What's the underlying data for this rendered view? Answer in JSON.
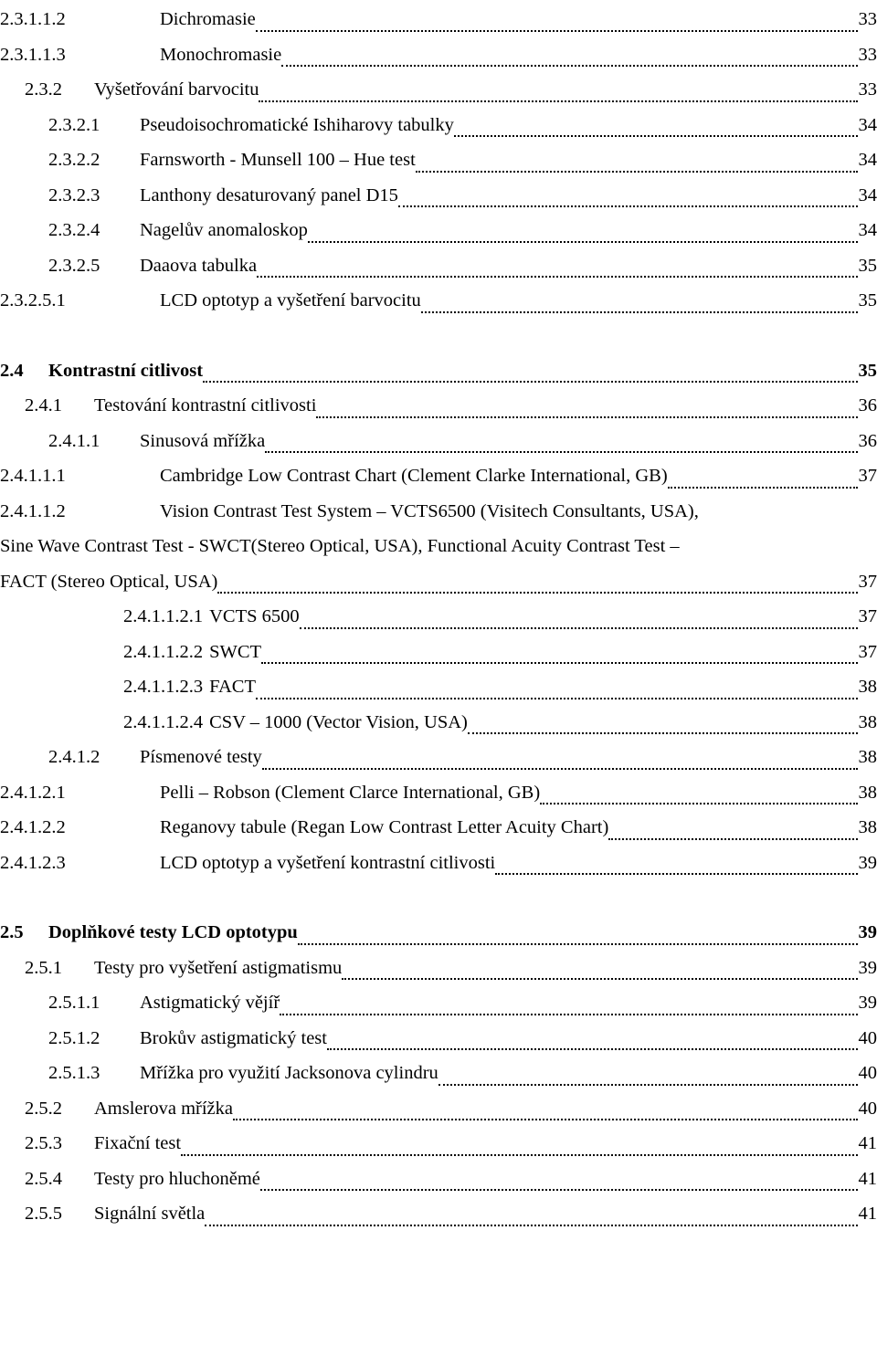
{
  "document": {
    "type": "table-of-contents",
    "language": "cs",
    "page_number_alignment": "right",
    "leader": "dotted"
  },
  "entries": [
    {
      "number": "2.3.1.1.2",
      "title": "Dichromasie",
      "page": "33",
      "level": 5,
      "bold": false
    },
    {
      "number": "2.3.1.1.3",
      "title": "Monochromasie",
      "page": "33",
      "level": 5,
      "bold": false
    },
    {
      "number": "2.3.2",
      "title": "Vyšetřování barvocitu",
      "page": "33",
      "level": 3,
      "bold": false
    },
    {
      "number": "2.3.2.1",
      "title": "Pseudoisochromatické Ishiharovy tabulky",
      "page": "34",
      "level": 4,
      "bold": false
    },
    {
      "number": "2.3.2.2",
      "title": "Farnsworth - Munsell 100 – Hue test",
      "page": "34",
      "level": 4,
      "bold": false
    },
    {
      "number": "2.3.2.3",
      "title": "Lanthony desaturovaný panel D15",
      "page": "34",
      "level": 4,
      "bold": false
    },
    {
      "number": "2.3.2.4",
      "title": "Nagelův anomaloskop",
      "page": "34",
      "level": 4,
      "bold": false
    },
    {
      "number": "2.3.2.5",
      "title": "Daaova tabulka",
      "page": "35",
      "level": 4,
      "bold": false
    },
    {
      "number": "2.3.2.5.1",
      "title": "LCD optotyp a vyšetření barvocitu",
      "page": "35",
      "level": 5,
      "bold": false
    },
    {
      "number": "2.4",
      "title": "Kontrastní citlivost",
      "page": "35",
      "level": 2,
      "bold": true,
      "space_before": true
    },
    {
      "number": "2.4.1",
      "title": "Testování kontrastní citlivosti",
      "page": "36",
      "level": 3,
      "bold": false
    },
    {
      "number": "2.4.1.1",
      "title": "Sinusová mřížka",
      "page": "36",
      "level": 4,
      "bold": false
    },
    {
      "number": "2.4.1.1.1",
      "title": "Cambridge Low Contrast Chart (Clement Clarke International, GB)",
      "page": "37",
      "level": 5,
      "bold": false
    },
    {
      "number": "2.4.1.1.2",
      "title": "Vision Contrast Test System – VCTS6500 (Visitech Consultants, USA),",
      "title_line2": "Sine Wave Contrast Test - SWCT(Stereo Optical, USA), Functional Acuity Contrast Test –",
      "title_line3": "FACT (Stereo Optical, USA)",
      "page": "37",
      "level": 5,
      "bold": false,
      "multiline": true
    },
    {
      "number": "2.4.1.1.2.1",
      "title": "VCTS 6500",
      "page": "37",
      "level": 6,
      "bold": false
    },
    {
      "number": "2.4.1.1.2.2",
      "title": "SWCT",
      "page": "37",
      "level": 6,
      "bold": false
    },
    {
      "number": "2.4.1.1.2.3",
      "title": "FACT",
      "page": "38",
      "level": 6,
      "bold": false
    },
    {
      "number": "2.4.1.1.2.4",
      "title": "CSV – 1000 (Vector Vision, USA)",
      "page": "38",
      "level": 6,
      "bold": false
    },
    {
      "number": "2.4.1.2",
      "title": "Písmenové testy",
      "page": "38",
      "level": 4,
      "bold": false
    },
    {
      "number": "2.4.1.2.1",
      "title": "Pelli – Robson (Clement Clarce International, GB)",
      "page": "38",
      "level": 5,
      "bold": false
    },
    {
      "number": "2.4.1.2.2",
      "title": "Reganovy tabule (Regan Low Contrast Letter Acuity Chart)",
      "page": "38",
      "level": 5,
      "bold": false
    },
    {
      "number": "2.4.1.2.3",
      "title": "LCD optotyp a vyšetření kontrastní citlivosti",
      "page": "39",
      "level": 5,
      "bold": false
    },
    {
      "number": "2.5",
      "title": "Doplňkové testy LCD optotypu",
      "page": "39",
      "level": 2,
      "bold": true,
      "space_before": true
    },
    {
      "number": "2.5.1",
      "title": "Testy pro vyšetření astigmatismu",
      "page": "39",
      "level": 3,
      "bold": false
    },
    {
      "number": "2.5.1.1",
      "title": "Astigmatický vějíř",
      "page": "39",
      "level": 4,
      "bold": false
    },
    {
      "number": "2.5.1.2",
      "title": "Brokův astigmatický test",
      "page": "40",
      "level": 4,
      "bold": false
    },
    {
      "number": "2.5.1.3",
      "title": "Mřížka pro využití Jacksonova cylindru",
      "page": "40",
      "level": 4,
      "bold": false
    },
    {
      "number": "2.5.2",
      "title": "Amslerova mřížka",
      "page": "40",
      "level": 3,
      "bold": false
    },
    {
      "number": "2.5.3",
      "title": "Fixační test",
      "page": "41",
      "level": 3,
      "bold": false
    },
    {
      "number": "2.5.4",
      "title": "Testy pro hluchoněmé",
      "page": "41",
      "level": 3,
      "bold": false
    },
    {
      "number": "2.5.5",
      "title": "Signální světla",
      "page": "41",
      "level": 3,
      "bold": false
    }
  ]
}
